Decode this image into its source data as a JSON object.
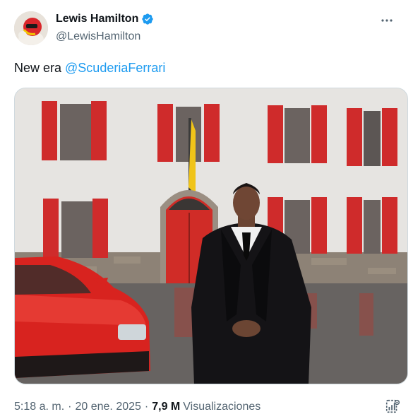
{
  "author": {
    "display_name": "Lewis Hamilton",
    "handle": "@LewisHamilton",
    "verified": true,
    "avatar_icon": "profile-avatar"
  },
  "tweet": {
    "text_prefix": "New era ",
    "mention": "@ScuderiaFerrari"
  },
  "media": {
    "description_icon": "photo"
  },
  "footer": {
    "time": "5:18 a. m.",
    "separator1": "·",
    "date": "20 ene. 2025",
    "separator2": "·",
    "views_count": "7,9 M",
    "views_label": "Visualizaciones"
  },
  "colors": {
    "accent": "#1d9bf0",
    "verified": "#1d9bf0",
    "muted": "#536471",
    "text": "#0f1419"
  }
}
